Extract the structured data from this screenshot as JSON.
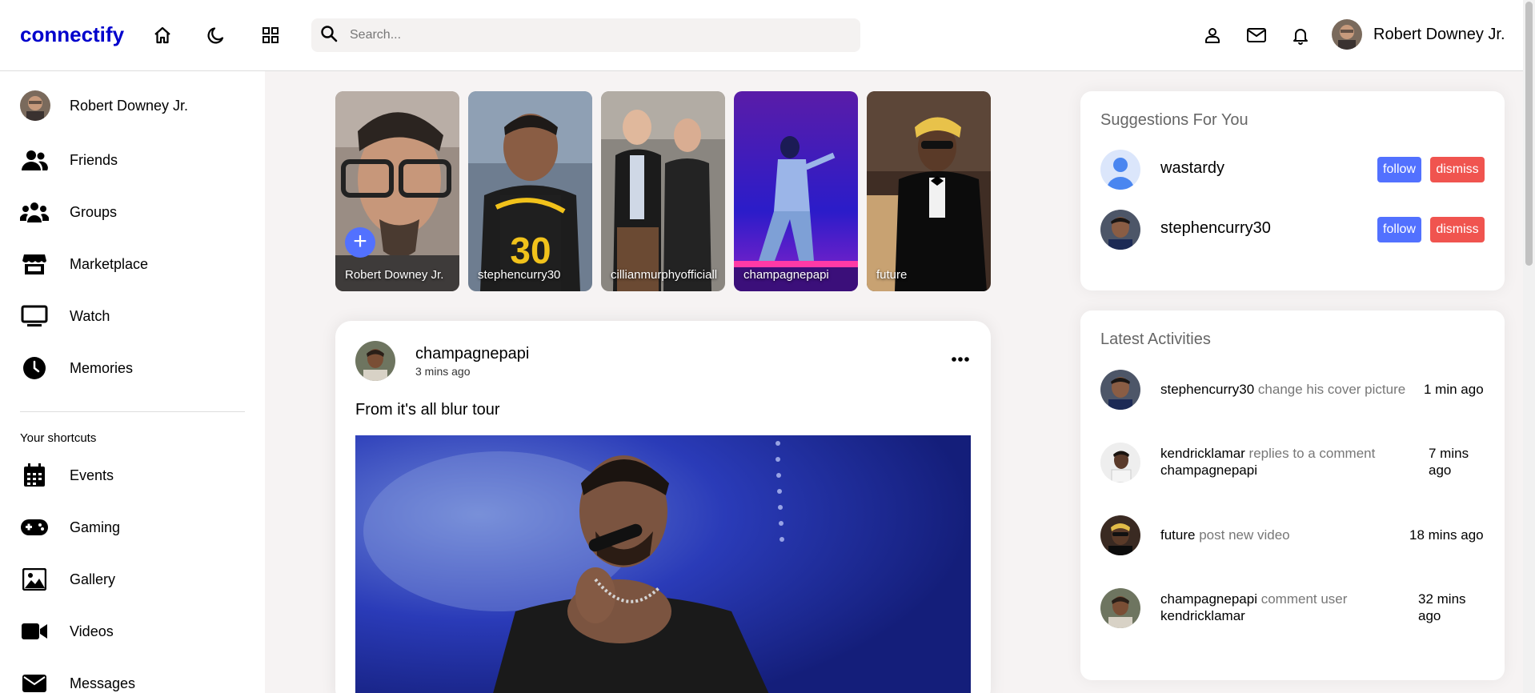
{
  "app": {
    "logo": "connectify"
  },
  "search": {
    "placeholder": "Search..."
  },
  "current_user": {
    "name": "Robert Downey Jr."
  },
  "sidebar": {
    "profile_name": "Robert Downey Jr.",
    "menu": [
      {
        "label": "Friends",
        "icon": "friends-icon"
      },
      {
        "label": "Groups",
        "icon": "groups-icon"
      },
      {
        "label": "Marketplace",
        "icon": "store-icon"
      },
      {
        "label": "Watch",
        "icon": "tv-icon"
      },
      {
        "label": "Memories",
        "icon": "clock-icon"
      }
    ],
    "shortcuts_title": "Your shortcuts",
    "shortcuts": [
      {
        "label": "Events",
        "icon": "calendar-icon"
      },
      {
        "label": "Gaming",
        "icon": "gamepad-icon"
      },
      {
        "label": "Gallery",
        "icon": "image-icon"
      },
      {
        "label": "Videos",
        "icon": "video-icon"
      },
      {
        "label": "Messages",
        "icon": "envelope-icon"
      }
    ]
  },
  "stories": [
    {
      "name": "Robert Downey Jr."
    },
    {
      "name": "stephencurry30"
    },
    {
      "name": "cillianmurphyofficiall"
    },
    {
      "name": "champagnepapi"
    },
    {
      "name": "future"
    }
  ],
  "story_add_symbol": "+",
  "post": {
    "author": "champagnepapi",
    "time": "3 mins ago",
    "text": "From it's all blur tour"
  },
  "suggestions": {
    "title": "Suggestions For You",
    "follow_label": "follow",
    "dismiss_label": "dismiss",
    "users": [
      {
        "name": "wastardy"
      },
      {
        "name": "stephencurry30"
      }
    ]
  },
  "activities": {
    "title": "Latest Activities",
    "items": [
      {
        "user": "stephencurry30",
        "action": "change his cover picture",
        "extra": "",
        "time": "1 min ago"
      },
      {
        "user": "kendricklamar",
        "action": "replies to a comment",
        "extra": "champagnepapi",
        "time": "7 mins ago"
      },
      {
        "user": "future",
        "action": "post new video",
        "extra": "",
        "time": "18 mins ago"
      },
      {
        "user": "champagnepapi",
        "action": "comment user",
        "extra": "kendricklamar",
        "time": "32 mins ago"
      }
    ]
  },
  "colors": {
    "brand": "#0000cc",
    "follow": "#5271ff",
    "dismiss": "#f0544f"
  }
}
